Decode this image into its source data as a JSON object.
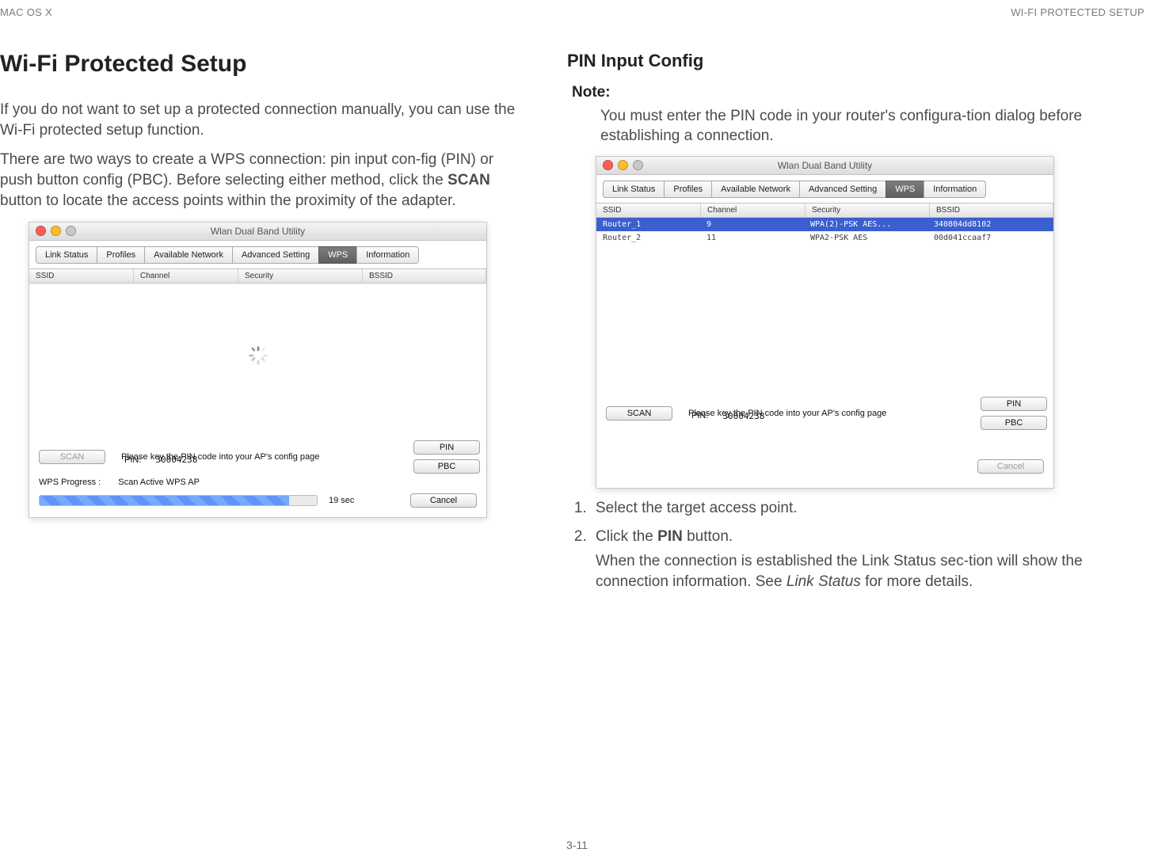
{
  "header": {
    "left": "MAC OS X",
    "right": "WI-FI PROTECTED SETUP"
  },
  "left": {
    "h1": "Wi-Fi Protected Setup",
    "p1": "If you do not want to set up a protected connection manually, you can use the Wi-Fi protected setup function.",
    "p2a": "There are two ways to create a WPS connection: pin input con-fig (PIN) or push button config (PBC). Before selecting either method, click the ",
    "p2b_bold": "SCAN",
    "p2c": " button to locate the access points within the proximity of the adapter."
  },
  "right": {
    "h2": "PIN Input Config",
    "note_label": "Note:",
    "note_body": "You must enter the PIN code in your router's configura-tion dialog before establishing a connection.",
    "li1": "Select the target access point.",
    "li2a": "Click the ",
    "li2_bold": "PIN",
    "li2b": " button.",
    "li_sub_a": "When the connection is established the Link Status sec-tion will show the connection information. See ",
    "li_sub_em": "Link Status",
    "li_sub_b": " for more details."
  },
  "win": {
    "title": "Wlan Dual Band Utility",
    "tabs": [
      "Link Status",
      "Profiles",
      "Available Network",
      "Advanced Setting",
      "WPS",
      "Information"
    ],
    "columns": {
      "ssid": "SSID",
      "channel": "Channel",
      "security": "Security",
      "bssid": "BSSID"
    },
    "hint": "Please key the PIN code into your AP's config page",
    "pin_label": "PIN:",
    "pin_value": "30004238",
    "scan": "SCAN",
    "pin_btn": "PIN",
    "pbc_btn": "PBC",
    "cancel": "Cancel",
    "wps_progress_label": "WPS Progress :",
    "wps_progress_status": "Scan Active WPS AP",
    "progress_time": "19 sec"
  },
  "rows": [
    {
      "ssid": "Router_1",
      "channel": "9",
      "security": "WPA(2)-PSK AES...",
      "bssid": "340804dd8102",
      "selected": true
    },
    {
      "ssid": "Router_2",
      "channel": "11",
      "security": "WPA2-PSK AES",
      "bssid": "00d041ccaaf7",
      "selected": false
    }
  ],
  "page_number": "3-11"
}
